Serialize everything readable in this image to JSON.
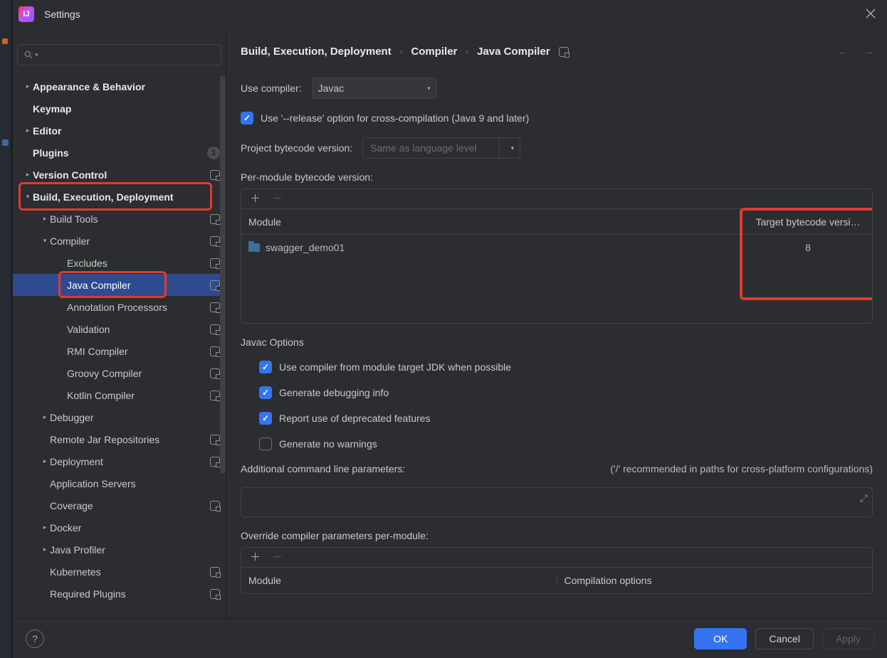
{
  "title": "Settings",
  "sidebar": {
    "items": [
      {
        "label": "Appearance & Behavior",
        "arrow": "right",
        "bold": true,
        "level": 0
      },
      {
        "label": "Keymap",
        "arrow": "",
        "bold": true,
        "level": 0
      },
      {
        "label": "Editor",
        "arrow": "right",
        "bold": true,
        "level": 0
      },
      {
        "label": "Plugins",
        "arrow": "",
        "bold": true,
        "level": 0,
        "badge": "1"
      },
      {
        "label": "Version Control",
        "arrow": "right",
        "bold": true,
        "level": 0,
        "proj": true
      },
      {
        "label": "Build, Execution, Deployment",
        "arrow": "down",
        "bold": true,
        "level": 0,
        "redbox": true
      },
      {
        "label": "Build Tools",
        "arrow": "right",
        "bold": false,
        "level": 1,
        "proj": true
      },
      {
        "label": "Compiler",
        "arrow": "down",
        "bold": false,
        "level": 1,
        "proj": true
      },
      {
        "label": "Excludes",
        "arrow": "",
        "bold": false,
        "level": 2,
        "proj": true
      },
      {
        "label": "Java Compiler",
        "arrow": "",
        "bold": false,
        "level": 2,
        "proj": true,
        "selected": true,
        "redbox2": true
      },
      {
        "label": "Annotation Processors",
        "arrow": "",
        "bold": false,
        "level": 2,
        "proj": true
      },
      {
        "label": "Validation",
        "arrow": "",
        "bold": false,
        "level": 2,
        "proj": true
      },
      {
        "label": "RMI Compiler",
        "arrow": "",
        "bold": false,
        "level": 2,
        "proj": true
      },
      {
        "label": "Groovy Compiler",
        "arrow": "",
        "bold": false,
        "level": 2,
        "proj": true
      },
      {
        "label": "Kotlin Compiler",
        "arrow": "",
        "bold": false,
        "level": 2,
        "proj": true
      },
      {
        "label": "Debugger",
        "arrow": "right",
        "bold": false,
        "level": 1
      },
      {
        "label": "Remote Jar Repositories",
        "arrow": "",
        "bold": false,
        "level": 1,
        "proj": true
      },
      {
        "label": "Deployment",
        "arrow": "right",
        "bold": false,
        "level": 1,
        "proj": true
      },
      {
        "label": "Application Servers",
        "arrow": "",
        "bold": false,
        "level": 1
      },
      {
        "label": "Coverage",
        "arrow": "",
        "bold": false,
        "level": 1,
        "proj": true
      },
      {
        "label": "Docker",
        "arrow": "right",
        "bold": false,
        "level": 1
      },
      {
        "label": "Java Profiler",
        "arrow": "right",
        "bold": false,
        "level": 1
      },
      {
        "label": "Kubernetes",
        "arrow": "",
        "bold": false,
        "level": 1,
        "proj": true
      },
      {
        "label": "Required Plugins",
        "arrow": "",
        "bold": false,
        "level": 1,
        "proj": true
      }
    ]
  },
  "breadcrumbs": [
    "Build, Execution, Deployment",
    "Compiler",
    "Java Compiler"
  ],
  "main": {
    "use_compiler_label": "Use compiler:",
    "use_compiler_value": "Javac",
    "release_option": "Use '--release' option for cross-compilation (Java 9 and later)",
    "project_bytecode_label": "Project bytecode version:",
    "project_bytecode_placeholder": "Same as language level",
    "per_module_label": "Per-module bytecode version:",
    "col_module": "Module",
    "col_target": "Target bytecode versi…",
    "module_row_name": "swagger_demo01",
    "module_row_target": "8",
    "javac_options": "Javac Options",
    "opt_module_jdk": "Use compiler from module target JDK when possible",
    "opt_debug": "Generate debugging info",
    "opt_deprecated": "Report use of deprecated features",
    "opt_nowarn": "Generate no warnings",
    "additional_label": "Additional command line parameters:",
    "additional_hint": "('/' recommended in paths for cross-platform configurations)",
    "override_label": "Override compiler parameters per-module:",
    "override_col_module": "Module",
    "override_col_opts": "Compilation options"
  },
  "footer": {
    "ok": "OK",
    "cancel": "Cancel",
    "apply": "Apply"
  }
}
